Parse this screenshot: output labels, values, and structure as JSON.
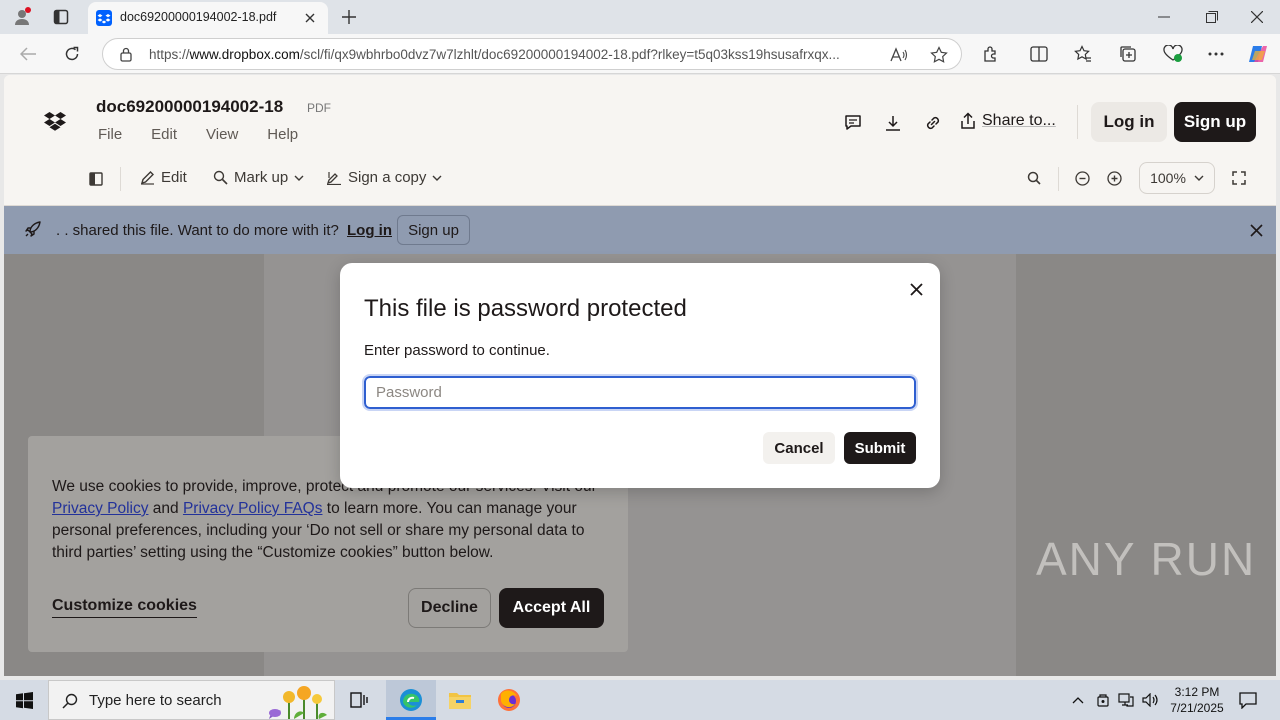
{
  "browser": {
    "tab_title": "doc69200000194002-18.pdf",
    "url_prefix": "https://",
    "url_host": "www.dropbox.com",
    "url_path": "/scl/fi/qx9wbhrbo0dvz7w7lzhlt/doc69200000194002-18.pdf?rlkey=t5q03kss19hsusafrxqx..."
  },
  "header": {
    "doc_title": "doc69200000194002-18",
    "doc_type": "PDF",
    "menu": [
      "File",
      "Edit",
      "View",
      "Help"
    ],
    "share_label": "Share to...",
    "login_label": "Log in",
    "signup_label": "Sign up"
  },
  "toolbar": {
    "edit_label": "Edit",
    "markup_label": "Mark up",
    "sign_label": "Sign a copy",
    "zoom_value": "100%"
  },
  "banner": {
    "text": ". . shared this file. Want to do more with it?",
    "login_label": "Log in",
    "signup_label": "Sign up"
  },
  "cookie": {
    "text_1": "We use cookies to provide, improve, protect and promote our services. Visit our ",
    "privacy_link": "Privacy Policy",
    "text_2": " and ",
    "faq_link": "Privacy Policy FAQs",
    "text_3": " to learn more. You can manage your personal preferences, including your ‘Do not sell or share my personal data to third parties’ setting using the “Customize cookies” button below.",
    "customize_label": "Customize cookies",
    "decline_label": "Decline",
    "accept_label": "Accept All"
  },
  "modal": {
    "title": "This file is password protected",
    "description": "Enter password to continue.",
    "password_placeholder": "Password",
    "password_value": "",
    "cancel_label": "Cancel",
    "submit_label": "Submit"
  },
  "watermark": "ANY RUN",
  "taskbar": {
    "search_placeholder": "Type here to search",
    "time": "3:12 PM",
    "date": "7/21/2025"
  },
  "colors": {
    "dropbox_blue": "#0061fe",
    "dark": "#1e1919",
    "focus_ring": "#2f5fd0"
  }
}
